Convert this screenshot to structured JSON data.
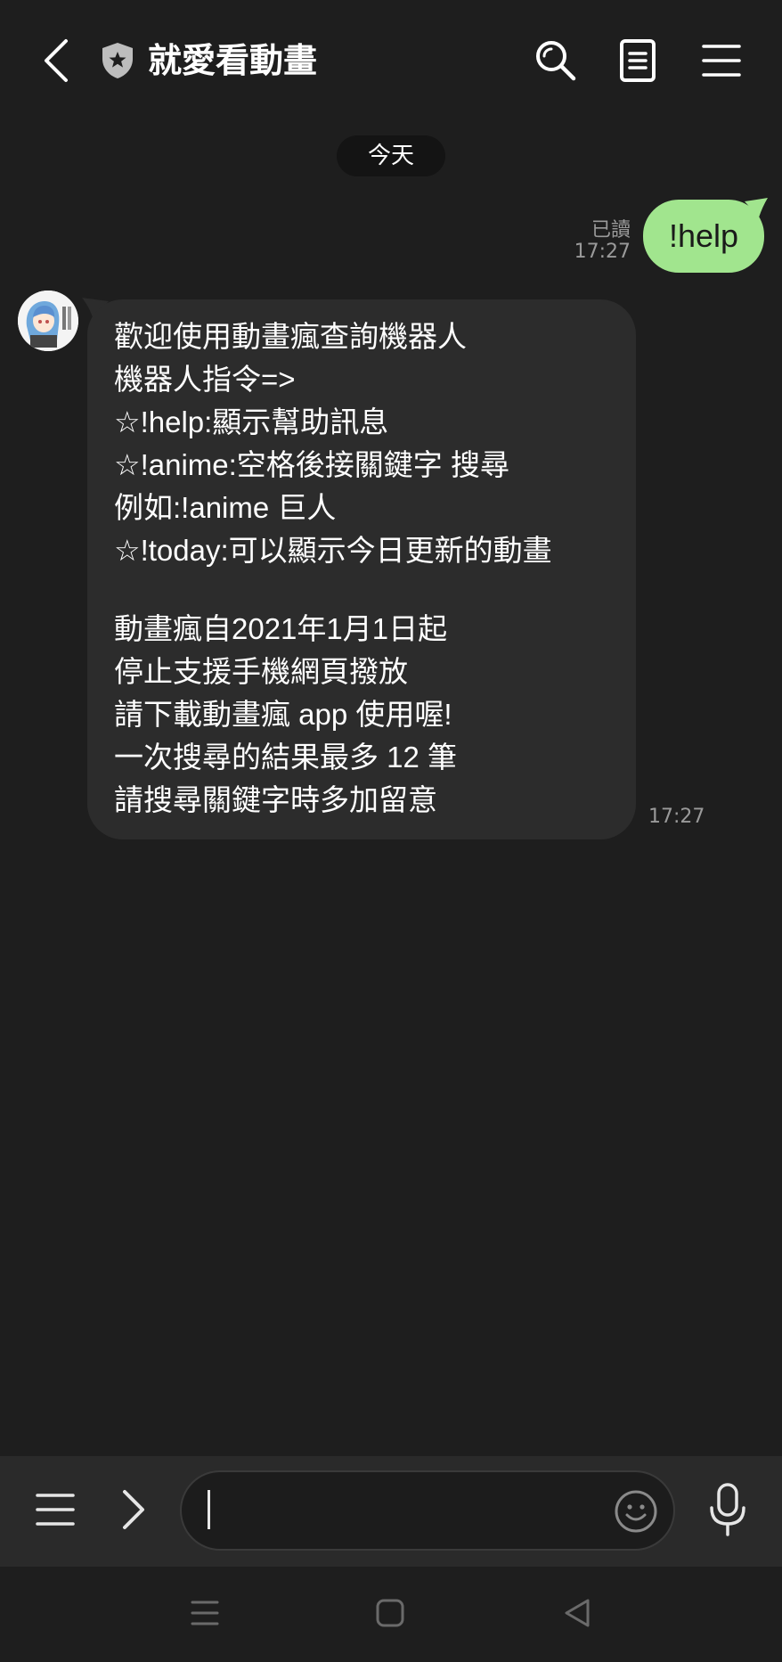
{
  "header": {
    "title": "就愛看動畫",
    "icons": [
      "back-icon",
      "shield-icon",
      "search-icon",
      "notes-icon",
      "menu-icon"
    ]
  },
  "chat": {
    "date_label": "今天",
    "outgoing": {
      "text": "!help",
      "read_status": "已讀",
      "time": "17:27",
      "color": "#a1e58e"
    },
    "incoming": {
      "lines": [
        "歡迎使用動畫瘋查詢機器人",
        "機器人指令=>",
        "☆!help:顯示幫助訊息",
        "☆!anime:空格後接關鍵字 搜尋",
        "例如:!anime 巨人",
        "☆!today:可以顯示今日更新的動畫",
        "",
        "動畫瘋自2021年1月1日起",
        "停止支援手機網頁撥放",
        "請下載動畫瘋 app 使用喔!",
        "一次搜尋的結果最多 12 筆",
        "請搜尋關鍵字時多加留意"
      ],
      "time": "17:27",
      "avatar_icon": "bot-avatar-icon"
    }
  },
  "input_bar": {
    "value": "",
    "icons": [
      "menu-icon",
      "chevron-right-icon",
      "emoji-icon",
      "mic-icon"
    ]
  },
  "nav_bar": {
    "icons": [
      "recents-icon",
      "home-icon",
      "back-triangle-icon"
    ]
  },
  "colors": {
    "background": "#1e1e1e",
    "incoming_bubble": "#2c2c2c",
    "outgoing_bubble": "#a1e58e",
    "input_bar": "#2a2a2a"
  }
}
